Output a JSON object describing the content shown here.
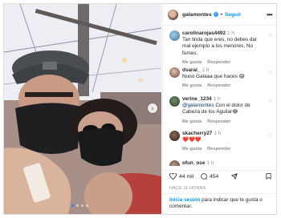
{
  "post": {
    "username": "galamontes",
    "separator": "•",
    "follow_label": "Seguir",
    "more_label": "•••",
    "photo_alt": "Selfie de galamontes con mascarilla y gorra",
    "likes": "44 mil",
    "comments_count": "454",
    "posted": "HACE 11 HORAS"
  },
  "comments": [
    {
      "user": "carolinarojas4492",
      "age": "1 h",
      "text": "Tan linda que eres, no debes dar mal ejemplo a los menores, No fumes.",
      "mention": "",
      "likes": "Me gusta",
      "reply": "Responder"
    },
    {
      "user": "dsarai_",
      "age": "1 h",
      "text": "Nooo Galaaa que haces 😱",
      "mention": "",
      "likes": "Me gusta",
      "reply": "Responder"
    },
    {
      "user": "verine_1234",
      "age": "1 h",
      "text": "Con el dolor de Cabeza de los Aguilar😂",
      "mention": "@galamontes",
      "likes": "Me gusta",
      "reply": "Responder"
    },
    {
      "user": "skacherry27",
      "age": "1 h",
      "text": "❤️❤️❤️",
      "mention": "",
      "likes": "Me gusta",
      "reply": "Responder"
    },
    {
      "user": "ofun_ose",
      "age": "1 h",
      "text": "",
      "mention": "",
      "likes": "",
      "reply": ""
    }
  ],
  "footer": {
    "login_label": "Inicia sesión",
    "rest_label": "para indicar que te gusta o comentar."
  },
  "icons": {
    "verified": "verified-badge-icon",
    "heart": "heart-icon",
    "comment": "comment-icon",
    "share": "share-icon",
    "save": "bookmark-icon",
    "next": "chevron-right-icon"
  },
  "colors": {
    "link_blue": "#0095f6",
    "verified_blue": "#3897f0",
    "meta_gray": "#8e8e8e"
  }
}
